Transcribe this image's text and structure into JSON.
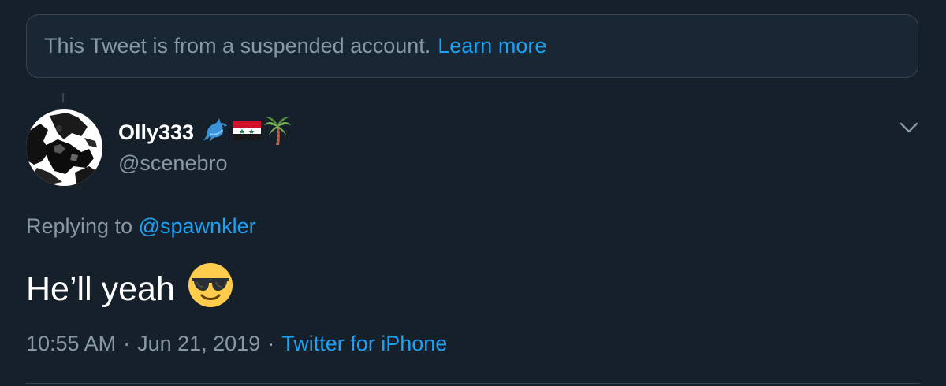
{
  "notice": {
    "text": "This Tweet is from a suspended account.",
    "link": "Learn more"
  },
  "author": {
    "display_name": "Olly333",
    "name_emojis": [
      "dolphin-icon",
      "syria-flag-icon",
      "palm-tree-icon"
    ],
    "handle": "@scenebro"
  },
  "reply": {
    "prefix": "Replying to",
    "mention": "@spawnkler"
  },
  "tweet": {
    "text": "He’ll yeah",
    "emoji": "sunglasses-face-icon"
  },
  "meta": {
    "time": "10:55 AM",
    "separator": "·",
    "date": "Jun 21, 2019",
    "source": "Twitter for iPhone"
  },
  "colors": {
    "background": "#15202b",
    "card": "#192734",
    "border": "#38444d",
    "secondary_text": "#8899a6",
    "link": "#1da1f2"
  }
}
